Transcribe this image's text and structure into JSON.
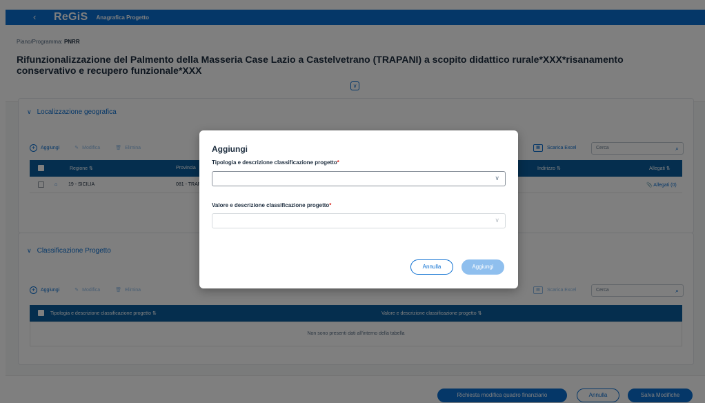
{
  "shellbar": {
    "back_icon": "chevron-left-icon",
    "logo": "ReGiS",
    "app_title": "Anagrafica Progetto"
  },
  "header": {
    "plan_label": "Piano/Programma:",
    "plan_value": "PNRR",
    "title": "Rifunzionalizzazione del Palmento della Masseria Case Lazio a Castelvetrano (TRAPANI) a scopito didattico rurale*XXX*risanamento conservativo e recupero funzionale*XXX"
  },
  "localizzazione": {
    "title": "Localizzazione geografica",
    "toolbar": {
      "add": "Aggiungi",
      "edit": "Modifica",
      "delete": "Elimina",
      "excel": "Scarica Excel",
      "search_placeholder": "Cerca"
    },
    "columns": {
      "regione": "Regione",
      "provincia": "Provincia",
      "indirizzo": "Indirizzo",
      "allegati": "Allegati"
    },
    "rows": [
      {
        "regione": "19 - SICILIA",
        "provincia": "081 - TRAP",
        "allegati": "Allegati (0)"
      }
    ]
  },
  "classificazione": {
    "title": "Classificazione Progetto",
    "toolbar": {
      "add": "Aggiungi",
      "edit": "Modifica",
      "delete": "Elimina",
      "excel": "Scarica Excel",
      "search_placeholder": "Cerca"
    },
    "columns": {
      "tipologia": "Tipologia e descrizione classificazione progetto",
      "valore": "Valore e descrizione classificazione progetto"
    },
    "empty": "Non sono presenti dati all'interno della tabella"
  },
  "footer": {
    "richiesta": "Richiesta modifica quadro finanziario",
    "annulla": "Annulla",
    "salva": "Salva Modifiche"
  },
  "dialog": {
    "title": "Aggiungi",
    "field1_label": "Tipologia e descrizione classificazione progetto",
    "field2_label": "Valore e descrizione classificazione progetto",
    "required_mark": "*",
    "cancel": "Annulla",
    "add": "Aggiungi"
  },
  "colors": {
    "brand": "#0a6ed1",
    "table_header": "#0a5c9c",
    "required": "#d9251c"
  }
}
